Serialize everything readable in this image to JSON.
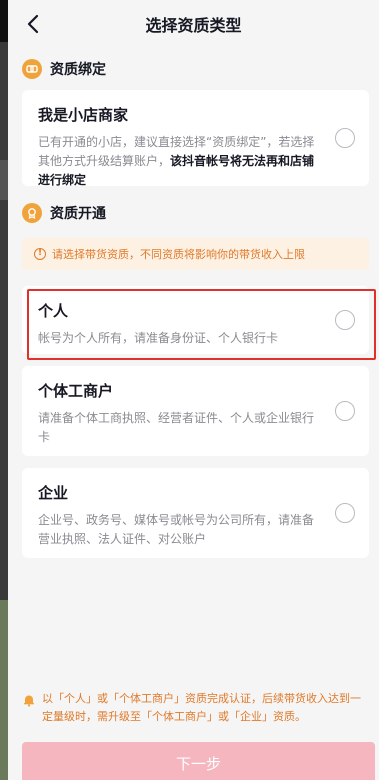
{
  "nav": {
    "title": "选择资质类型"
  },
  "binding_section": {
    "title": "资质绑定"
  },
  "shop_card": {
    "title": "我是小店商家",
    "desc_plain": "已有开通的小店，建议直接选择“资质绑定”，若选择其他方式升级结算账户，",
    "desc_bold": "该抖音帐号将无法再和店铺进行绑定"
  },
  "open_section": {
    "title": "资质开通"
  },
  "notice": {
    "text": "请选择带货资质，不同资质将影响你的带货收入上限"
  },
  "options": [
    {
      "title": "个人",
      "desc": "帐号为个人所有，请准备身份证、个人银行卡"
    },
    {
      "title": "个体工商户",
      "desc": "请准备个体工商执照、经营者证件、个人或企业银行卡"
    },
    {
      "title": "企业",
      "desc": "企业号、政务号、媒体号或帐号为公司所有，请准备营业执照、法人证件、对公账户"
    }
  ],
  "footer": {
    "note": "以「个人」或「个体工商户」资质完成认证，后续带货收入达到一定量级时，需升级至「个体工商户」或「企业」资质。",
    "next_label": "下一步"
  },
  "colors": {
    "accent_orange": "#f0a33a",
    "button_disabled": "#f5b6c0",
    "highlight_red": "#e0302a"
  }
}
